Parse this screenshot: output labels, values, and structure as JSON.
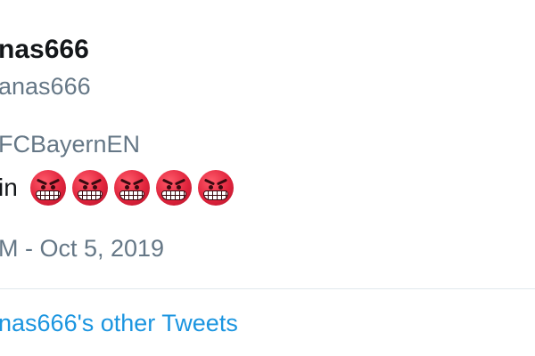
{
  "tweet": {
    "display_name": "nas666",
    "handle": "anas666",
    "reply_to": "FCBayernEN",
    "text_fragment": "in",
    "emoji": {
      "icon": "face-with-symbols-on-mouth-icon",
      "count": 5,
      "color": "#e0243c"
    },
    "timestamp": "M - Oct 5, 2019"
  },
  "footer": {
    "other_tweets_link": "nas666's other Tweets"
  },
  "colors": {
    "primary_text": "#14171a",
    "secondary_text": "#657786",
    "link": "#1b95e0",
    "divider": "#e1e8ed"
  }
}
